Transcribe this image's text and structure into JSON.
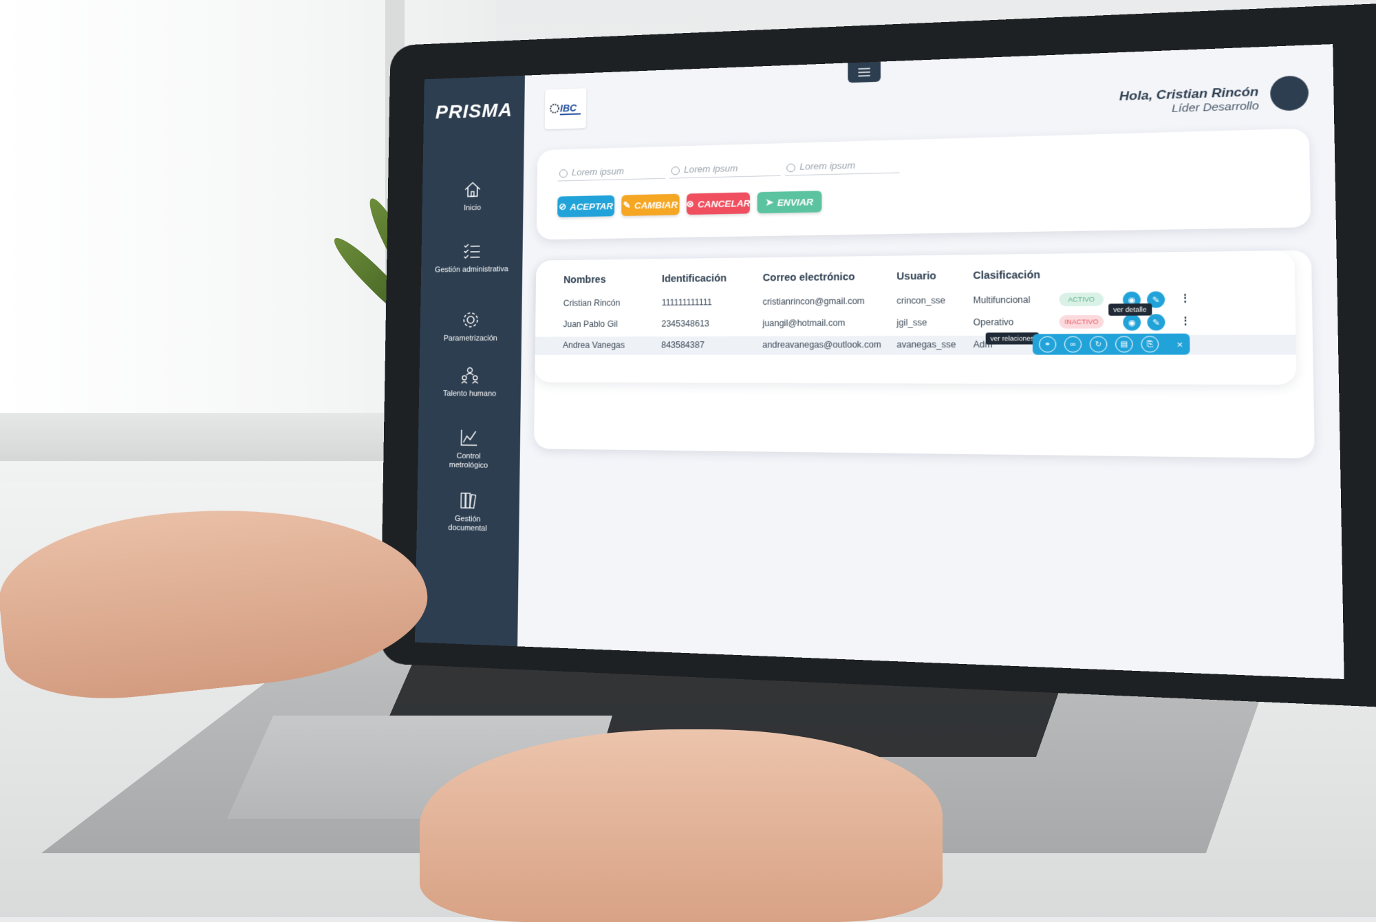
{
  "app": {
    "brand": "PRISMA",
    "logo_text": "IBC"
  },
  "sidebar": {
    "items": [
      {
        "label": "Inicio",
        "icon": "home-icon"
      },
      {
        "label": "Gestión administrativa",
        "icon": "checklist-icon"
      },
      {
        "label": "Parametrización",
        "icon": "gear-icon"
      },
      {
        "label": "Talento humano",
        "icon": "people-icon"
      },
      {
        "label": "Control metrológico",
        "icon": "chart-line-icon"
      },
      {
        "label": "Gestión documental",
        "icon": "documents-icon"
      }
    ]
  },
  "header": {
    "menu_icon": "hamburger-icon",
    "greeting": "Hola, Cristian Rincón",
    "role": "Líder Desarrollo"
  },
  "form": {
    "fields": [
      {
        "placeholder": "Lorem ipsum",
        "icon": "user-icon"
      },
      {
        "placeholder": "Lorem ipsum",
        "icon": "user-icon"
      },
      {
        "placeholder": "Lorem ipsum",
        "icon": "user-icon"
      }
    ],
    "buttons": [
      {
        "label": "ACEPTAR",
        "color": "#21a3d9",
        "icon": "check-circle-icon"
      },
      {
        "label": "CAMBIAR",
        "color": "#f5a623",
        "icon": "edit-icon"
      },
      {
        "label": "CANCELAR",
        "color": "#ef4f5f",
        "icon": "cancel-circle-icon"
      },
      {
        "label": "ENVIAR",
        "color": "#5cc3a0",
        "icon": "send-icon"
      }
    ]
  },
  "table": {
    "headers": [
      "Nombres",
      "Identificación",
      "Correo electrónico",
      "Usuario",
      "Clasificación"
    ],
    "rows": [
      {
        "nombre": "Cristian Rincón",
        "id": "111111111111",
        "correo": "cristianrincon@gmail.com",
        "usuario": "crincon_sse",
        "clasificacion": "Multifuncional",
        "estado": "ACTIVO"
      },
      {
        "nombre": "Juan Pablo Gil",
        "id": "2345348613",
        "correo": "juangil@hotmail.com",
        "usuario": "jgil_sse",
        "clasificacion": "Operativo",
        "estado": "INACTIVO"
      },
      {
        "nombre": "Andrea Vanegas",
        "id": "843584387",
        "correo": "andreavanegas@outlook.com",
        "usuario": "avanegas_sse",
        "clasificacion": "Adm",
        "estado": ""
      }
    ],
    "tooltips": {
      "view": "ver detalle",
      "relations": "ver relaciones"
    },
    "action_bar_close": "×",
    "kebab": "⋮"
  },
  "colors": {
    "sidebar": "#2d3e50",
    "accent": "#21a3d9",
    "active_bg": "#d9f1e6",
    "inactive_bg": "#fbdadd"
  }
}
